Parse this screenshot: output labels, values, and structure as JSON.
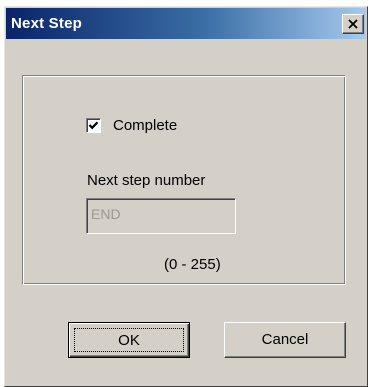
{
  "window": {
    "title": "Next Step"
  },
  "options": {
    "complete_label": "Complete",
    "complete_checked": true
  },
  "next_step": {
    "label": "Next step number",
    "value": "END",
    "range": "(0 - 255)"
  },
  "buttons": {
    "ok": "OK",
    "cancel": "Cancel"
  },
  "icons": {
    "close": "close-icon",
    "check": "checkmark-icon"
  }
}
